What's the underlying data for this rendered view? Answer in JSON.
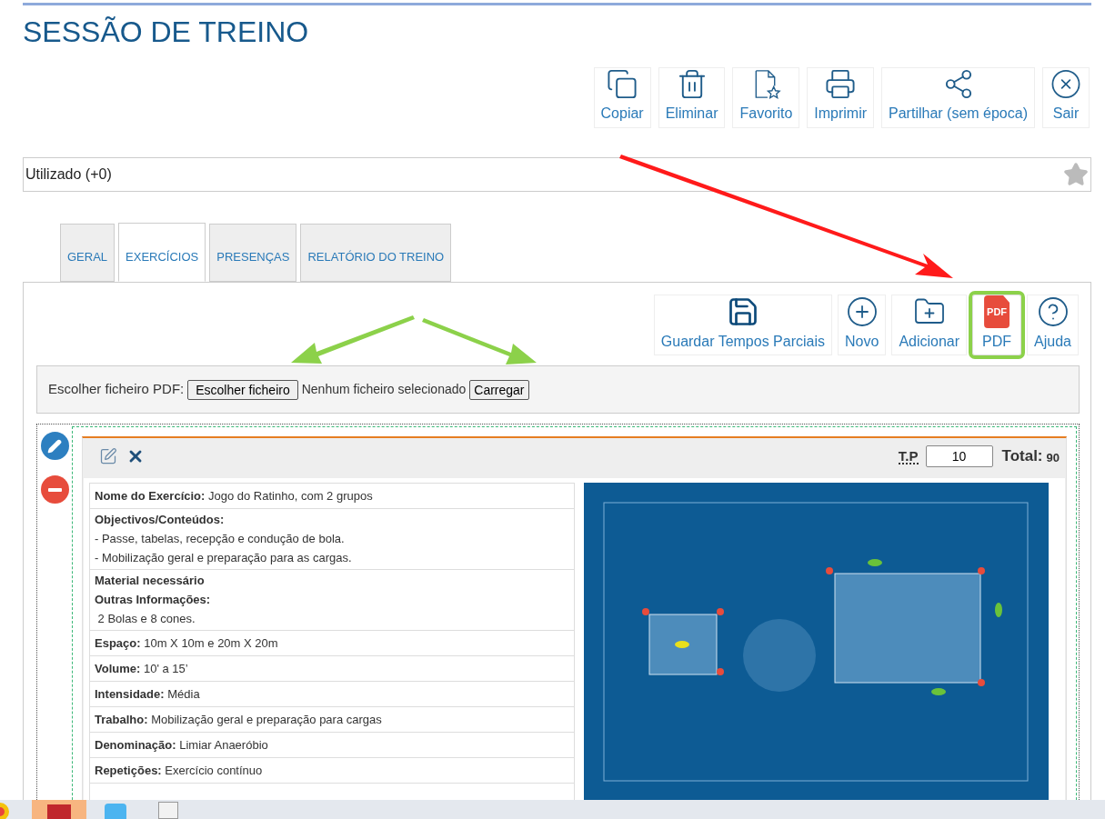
{
  "title": "SESSÃO DE TREINO",
  "toolbar": [
    {
      "kind": "copy",
      "label": "Copiar"
    },
    {
      "kind": "trash",
      "label": "Eliminar"
    },
    {
      "kind": "favorite",
      "label": "Favorito"
    },
    {
      "kind": "print",
      "label": "Imprimir"
    },
    {
      "kind": "share",
      "label": "Partilhar (sem época)"
    },
    {
      "kind": "exit",
      "label": "Sair"
    }
  ],
  "usage": {
    "text": "Utilizado (+0)"
  },
  "tabs": [
    {
      "label": "GERAL",
      "selected": false
    },
    {
      "label": "EXERCÍCIOS",
      "selected": true
    },
    {
      "label": "PRESENÇAS",
      "selected": false
    },
    {
      "label": "RELATÓRIO DO TREINO",
      "selected": false
    }
  ],
  "panel_toolbar": [
    {
      "kind": "save",
      "label": "Guardar Tempos Parciais",
      "highlighted": false
    },
    {
      "kind": "new",
      "label": "Novo",
      "highlighted": false
    },
    {
      "kind": "add",
      "label": "Adicionar",
      "highlighted": false
    },
    {
      "kind": "pdf",
      "label": "PDF",
      "icon_text": "PDF",
      "highlighted": true
    },
    {
      "kind": "help",
      "label": "Ajuda",
      "highlighted": false
    }
  ],
  "upload": {
    "label": "Escolher ficheiro PDF:",
    "choose_button": "Escolher ficheiro",
    "status": "Nenhum ficheiro selecionado",
    "upload_button": "Carregar"
  },
  "exercise": {
    "tp_label": "T.P",
    "tp_value": "10",
    "total_label": "Total:",
    "total_value": "90",
    "rows": [
      {
        "kind": "inline",
        "label": "Nome do Exercício:",
        "value": "Jogo do Ratinho, com 2 grupos"
      },
      {
        "kind": "block",
        "headings": [
          "Objectivos/Conteúdos:"
        ],
        "lines": [
          "- Passe, tabelas, recepção e condução de bola.",
          "- Mobilização geral e preparação para as cargas."
        ]
      },
      {
        "kind": "block",
        "headings": [
          "Material necessário",
          "Outras Informações:"
        ],
        "lines": [
          " 2 Bolas e 8 cones."
        ]
      },
      {
        "kind": "inline",
        "label": "Espaço:",
        "value": "10m X 10m e 20m X 20m"
      },
      {
        "kind": "inline",
        "label": "Volume:",
        "value": "10' a 15’"
      },
      {
        "kind": "inline",
        "label": "Intensidade:",
        "value": "Média"
      },
      {
        "kind": "inline",
        "label": "Trabalho:",
        "value": "Mobilização geral e preparação para cargas"
      },
      {
        "kind": "inline",
        "label": "Denominação:",
        "value": "Limiar Anaeróbio"
      },
      {
        "kind": "inline",
        "label": "Repetições:",
        "value": "Exercício contínuo"
      }
    ],
    "diagram": {
      "kind": "picture"
    }
  },
  "annotations": {
    "red_arrow": true,
    "green_arrows": true
  }
}
